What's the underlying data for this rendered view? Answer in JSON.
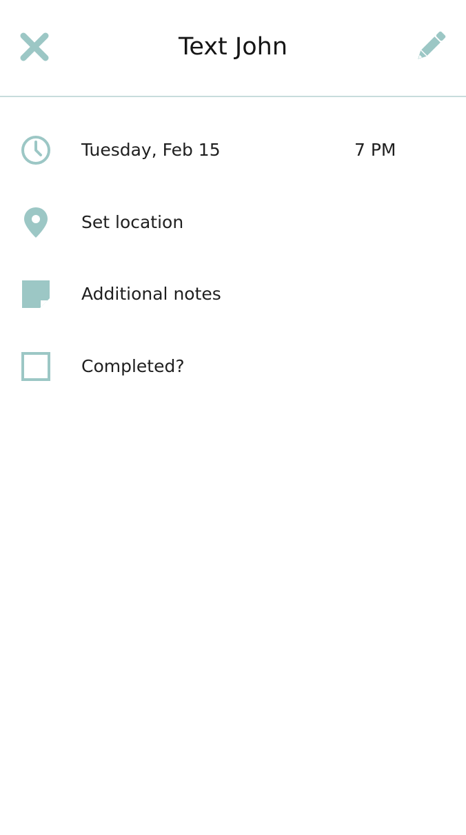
{
  "header": {
    "title": "Text John",
    "close_icon": "close-icon",
    "edit_icon": "pencil-icon"
  },
  "details": {
    "date": "Tuesday, Feb 15",
    "time": "7 PM",
    "location_placeholder": "Set location",
    "notes_placeholder": "Additional notes",
    "completed_label": "Completed?",
    "completed_checked": false
  },
  "icons": {
    "clock": "clock-icon",
    "location": "map-pin-icon",
    "notes": "sticky-note-icon",
    "checkbox": "checkbox-icon"
  },
  "colors": {
    "accent": "#9cc7c5",
    "divider": "#c7dcdc",
    "text": "#1f1f1f",
    "background": "#ffffff"
  }
}
